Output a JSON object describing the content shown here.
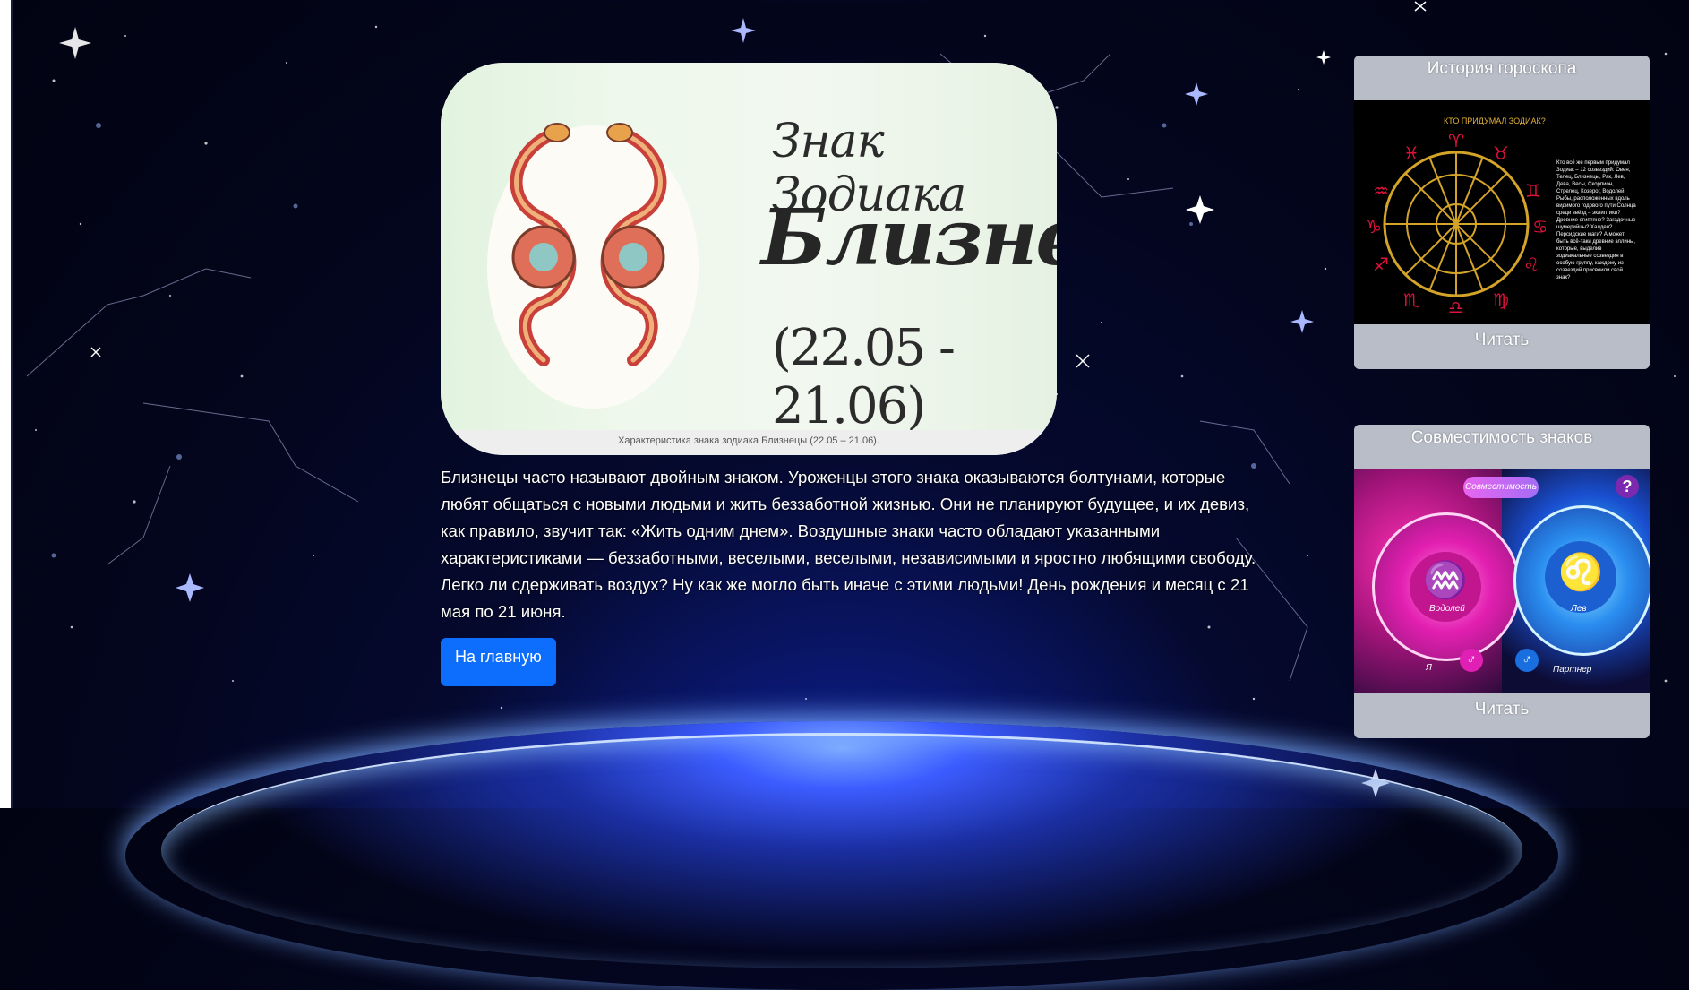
{
  "hero": {
    "title_line1": "Знак Зодиака",
    "title_line2": "Близнецы",
    "title_line3": "(22.05 - 21.06)",
    "caption": "Характеристика знака зодиака Близнецы (22.05 – 21.06).",
    "image_icon": "gemini-snakes-icon"
  },
  "description": "Близнецы часто называют двойным знаком. Уроженцы этого знака оказываются болтунами, которые любят общаться с новыми людьми и жить беззаботной жизнью. Они не планируют будущее, и их девиз, как правило, звучит так: «Жить одним днем». Воздушные знаки часто обладают указанными характеристиками — беззаботными, веселыми, веселыми, независимыми и яростно любящими свободу. Легко ли сдерживать воздух? Ну как же могло быть иначе с этими людьми! День рождения и месяц с 21 мая по 21 июня.",
  "home_button": "На главную",
  "sidebar": {
    "cards": [
      {
        "title": "История гороскопа",
        "button": "Читать",
        "image": {
          "heading": "КТО ПРИДУМАЛ ЗОДИАК?",
          "text": "Кто всё же первым придумал Зодиак – 12 созвездий: Овен, Телец, Близнецы, Рак, Лев, Дева, Весы, Скорпион, Стрелец, Козерог, Водолей, Рыбы, расположенных вдоль видимого годового пути Солнца среди звёзд – эклиптики? Древние египтяне? Загадочные шумерийцы? Халдеи? Персидские маги? А может быть всё-таки древние эллины, которые, выделив зодиакальные созвездия в особую группу, каждому из созвездий присвоили свой знак?"
        }
      },
      {
        "title": "Совместимость знаков",
        "button": "Читать",
        "image": {
          "badge": "Совместимость",
          "question": "?",
          "left_sign": "Водолей",
          "right_sign": "Лев",
          "left_person": "Я",
          "right_person": "Партнер"
        }
      }
    ]
  },
  "colors": {
    "primary_button": "#0d6efd",
    "card_background": "#b9bdc7",
    "page_background": "#03051a"
  }
}
